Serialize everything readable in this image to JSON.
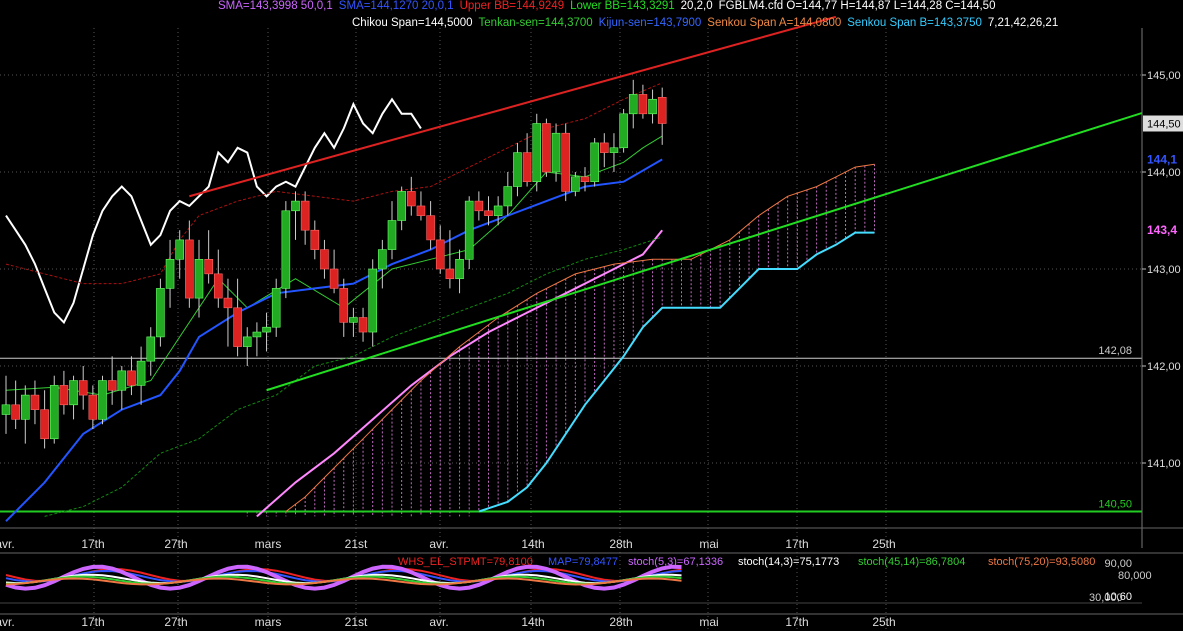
{
  "header": {
    "line1": [
      {
        "text": "SMA=143,3998  50,0,1",
        "color": "#cc66ff"
      },
      {
        "text": "SMA=144,1270  20,0,1",
        "color": "#3355ff"
      },
      {
        "text": "Upper BB=144,9249",
        "color": "#ee2222"
      },
      {
        "text": "Lower BB=143,3291",
        "color": "#22dd22"
      },
      {
        "text": "20,2,0",
        "color": "#ffffff"
      },
      {
        "text": "FGBLM4.cfd O=144,77 H=144,87 L=144,28 C=144,50",
        "color": "#ffffff"
      }
    ],
    "line2": [
      {
        "text": "Chikou Span=144,5000",
        "color": "#ffffff"
      },
      {
        "text": "Tenkan-sen=144,3700",
        "color": "#33cc33"
      },
      {
        "text": "Kijun-sen=143,7900",
        "color": "#3366ff"
      },
      {
        "text": "Senkou Span A=144,0800",
        "color": "#ee8844"
      },
      {
        "text": "Senkou Span B=143,3750",
        "color": "#33ccff"
      },
      {
        "text": "7,21,42,26,21",
        "color": "#ffffff"
      }
    ]
  },
  "chart_data": {
    "type": "candlestick",
    "symbol": "FGBLM4.cfd",
    "ylim": [
      140.4,
      145.4
    ],
    "y_ticks": [
      "145,00",
      "144,00",
      "143,00",
      "142,00",
      "141,00"
    ],
    "x_labels": [
      "avr.",
      "17th",
      "27th",
      "mars",
      "21st",
      "avr.",
      "14th",
      "28th",
      "mai",
      "17th",
      "25th"
    ],
    "price_tag": {
      "value": 144.5,
      "label": "144,50",
      "color": "#cccccc"
    },
    "indicator_tags": [
      {
        "value": 144.13,
        "label": "144,1",
        "color": "#3355ff"
      },
      {
        "value": 143.4,
        "label": "143,4",
        "color": "#ff66ff"
      }
    ],
    "hlines": [
      {
        "value": 142.08,
        "label": "142,08",
        "color": "#cccccc"
      },
      {
        "value": 140.5,
        "label": "140,50",
        "color": "#22cc22"
      }
    ],
    "trendlines": [
      {
        "name": "upper-trendline",
        "color": "#dd2222",
        "x1": 19,
        "y1": 143.75,
        "x2": 86,
        "y2": 145.6
      },
      {
        "name": "lower-trendline",
        "color": "#22dd22",
        "x1": 27,
        "y1": 141.75,
        "x2": 120,
        "y2": 144.68
      }
    ],
    "candles": [
      [
        141.5,
        141.9,
        141.3,
        141.6
      ],
      [
        141.6,
        141.85,
        141.35,
        141.45
      ],
      [
        141.45,
        141.8,
        141.2,
        141.7
      ],
      [
        141.7,
        141.85,
        141.4,
        141.55
      ],
      [
        141.55,
        141.75,
        141.15,
        141.25
      ],
      [
        141.25,
        141.9,
        141.2,
        141.8
      ],
      [
        141.8,
        141.95,
        141.5,
        141.6
      ],
      [
        141.6,
        141.9,
        141.45,
        141.85
      ],
      [
        141.85,
        142.0,
        141.55,
        141.7
      ],
      [
        141.7,
        141.8,
        141.35,
        141.45
      ],
      [
        141.45,
        141.9,
        141.4,
        141.85
      ],
      [
        141.85,
        142.1,
        141.6,
        141.75
      ],
      [
        141.75,
        142.0,
        141.55,
        141.95
      ],
      [
        141.95,
        142.1,
        141.7,
        141.8
      ],
      [
        141.8,
        142.2,
        141.6,
        142.05
      ],
      [
        142.05,
        142.4,
        141.9,
        142.3
      ],
      [
        142.3,
        142.9,
        142.2,
        142.8
      ],
      [
        142.8,
        143.3,
        142.6,
        143.1
      ],
      [
        143.1,
        143.4,
        142.9,
        143.3
      ],
      [
        143.3,
        143.5,
        142.6,
        142.7
      ],
      [
        142.7,
        143.3,
        142.5,
        143.1
      ],
      [
        143.1,
        143.4,
        142.85,
        142.95
      ],
      [
        142.95,
        143.2,
        142.6,
        142.7
      ],
      [
        142.7,
        142.9,
        142.2,
        142.6
      ],
      [
        142.6,
        142.9,
        142.1,
        142.2
      ],
      [
        142.2,
        142.4,
        142.0,
        142.3
      ],
      [
        142.3,
        142.45,
        142.1,
        142.35
      ],
      [
        142.35,
        142.55,
        142.15,
        142.4
      ],
      [
        142.4,
        142.9,
        142.3,
        142.8
      ],
      [
        142.8,
        143.7,
        142.7,
        143.6
      ],
      [
        143.6,
        143.8,
        143.3,
        143.7
      ],
      [
        143.7,
        143.8,
        143.25,
        143.4
      ],
      [
        143.4,
        143.5,
        143.1,
        143.2
      ],
      [
        143.2,
        143.3,
        142.9,
        143.0
      ],
      [
        143.0,
        143.2,
        142.75,
        142.8
      ],
      [
        142.8,
        142.9,
        142.3,
        142.45
      ],
      [
        142.45,
        142.6,
        142.3,
        142.5
      ],
      [
        142.5,
        142.6,
        142.25,
        142.35
      ],
      [
        142.35,
        143.1,
        142.2,
        143.0
      ],
      [
        143.0,
        143.3,
        142.8,
        143.2
      ],
      [
        143.2,
        143.7,
        143.1,
        143.5
      ],
      [
        143.5,
        143.85,
        143.4,
        143.8
      ],
      [
        143.8,
        143.95,
        143.55,
        143.65
      ],
      [
        143.65,
        143.8,
        143.5,
        143.55
      ],
      [
        143.55,
        143.7,
        143.2,
        143.3
      ],
      [
        143.3,
        143.45,
        142.95,
        143.0
      ],
      [
        143.0,
        143.4,
        142.8,
        142.9
      ],
      [
        142.9,
        143.2,
        142.75,
        143.1
      ],
      [
        143.1,
        143.75,
        143.0,
        143.7
      ],
      [
        143.7,
        143.8,
        143.5,
        143.6
      ],
      [
        143.6,
        143.75,
        143.45,
        143.55
      ],
      [
        143.55,
        143.75,
        143.45,
        143.65
      ],
      [
        143.65,
        144.0,
        143.55,
        143.85
      ],
      [
        143.85,
        144.3,
        143.75,
        144.2
      ],
      [
        144.2,
        144.4,
        143.85,
        143.9
      ],
      [
        143.9,
        144.6,
        143.8,
        144.5
      ],
      [
        144.5,
        144.55,
        143.95,
        144.0
      ],
      [
        144.0,
        144.5,
        143.9,
        144.4
      ],
      [
        144.4,
        144.5,
        143.7,
        143.8
      ],
      [
        143.8,
        144.0,
        143.75,
        143.95
      ],
      [
        143.95,
        144.05,
        143.8,
        143.9
      ],
      [
        143.9,
        144.35,
        143.85,
        144.3
      ],
      [
        144.3,
        144.4,
        144.05,
        144.2
      ],
      [
        144.2,
        144.4,
        144.0,
        144.25
      ],
      [
        144.25,
        144.65,
        144.2,
        144.6
      ],
      [
        144.6,
        144.95,
        144.45,
        144.8
      ],
      [
        144.8,
        144.9,
        144.55,
        144.6
      ],
      [
        144.6,
        144.85,
        144.5,
        144.75
      ],
      [
        144.77,
        144.87,
        144.28,
        144.5
      ]
    ],
    "series": [
      {
        "key": "chikou",
        "color": "#ffffff",
        "width": 2,
        "points": [
          [
            0,
            143.55
          ],
          [
            1,
            143.4
          ],
          [
            2,
            143.25
          ],
          [
            3,
            143.05
          ],
          [
            4,
            142.8
          ],
          [
            5,
            142.55
          ],
          [
            6,
            142.45
          ],
          [
            7,
            142.65
          ],
          [
            8,
            143.0
          ],
          [
            9,
            143.35
          ],
          [
            10,
            143.6
          ],
          [
            11,
            143.75
          ],
          [
            12,
            143.85
          ],
          [
            13,
            143.75
          ],
          [
            14,
            143.5
          ],
          [
            15,
            143.25
          ],
          [
            16,
            143.35
          ],
          [
            17,
            143.6
          ],
          [
            18,
            143.7
          ],
          [
            19,
            143.65
          ],
          [
            20,
            143.75
          ],
          [
            21,
            143.85
          ],
          [
            22,
            144.2
          ],
          [
            23,
            144.1
          ],
          [
            24,
            144.25
          ],
          [
            25,
            144.2
          ],
          [
            26,
            143.85
          ],
          [
            27,
            143.75
          ],
          [
            28,
            143.85
          ],
          [
            29,
            143.9
          ],
          [
            30,
            143.85
          ],
          [
            31,
            144.05
          ],
          [
            32,
            144.25
          ],
          [
            33,
            144.4
          ],
          [
            34,
            144.25
          ],
          [
            35,
            144.45
          ],
          [
            36,
            144.7
          ],
          [
            37,
            144.5
          ],
          [
            38,
            144.4
          ],
          [
            39,
            144.6
          ],
          [
            40,
            144.75
          ],
          [
            41,
            144.6
          ],
          [
            42,
            144.6
          ],
          [
            43,
            144.45
          ]
        ]
      },
      {
        "key": "tenkan",
        "color": "#33cc33",
        "width": 1,
        "points": [
          [
            0,
            141.75
          ],
          [
            5,
            141.78
          ],
          [
            10,
            141.7
          ],
          [
            15,
            141.85
          ],
          [
            18,
            142.3
          ],
          [
            22,
            142.9
          ],
          [
            25,
            142.6
          ],
          [
            30,
            142.9
          ],
          [
            35,
            142.6
          ],
          [
            40,
            143.0
          ],
          [
            44,
            143.1
          ],
          [
            48,
            143.2
          ],
          [
            52,
            143.55
          ],
          [
            56,
            144.0
          ],
          [
            60,
            143.95
          ],
          [
            64,
            144.1
          ],
          [
            66,
            144.25
          ],
          [
            68,
            144.37
          ]
        ]
      },
      {
        "key": "kijun",
        "color": "#2255ff",
        "width": 2,
        "points": [
          [
            0,
            140.4
          ],
          [
            4,
            140.8
          ],
          [
            8,
            141.3
          ],
          [
            12,
            141.55
          ],
          [
            16,
            141.7
          ],
          [
            18,
            141.95
          ],
          [
            20,
            142.3
          ],
          [
            24,
            142.55
          ],
          [
            28,
            142.75
          ],
          [
            32,
            142.8
          ],
          [
            36,
            142.85
          ],
          [
            40,
            143.05
          ],
          [
            44,
            143.2
          ],
          [
            48,
            143.4
          ],
          [
            52,
            143.55
          ],
          [
            56,
            143.7
          ],
          [
            60,
            143.85
          ],
          [
            64,
            143.9
          ],
          [
            68,
            144.13
          ]
        ]
      },
      {
        "key": "sma50",
        "color": "#ff88ff",
        "width": 2,
        "points": [
          [
            26,
            140.45
          ],
          [
            30,
            140.8
          ],
          [
            34,
            141.1
          ],
          [
            38,
            141.45
          ],
          [
            42,
            141.8
          ],
          [
            46,
            142.1
          ],
          [
            50,
            142.35
          ],
          [
            54,
            142.55
          ],
          [
            58,
            142.75
          ],
          [
            62,
            142.95
          ],
          [
            66,
            143.15
          ],
          [
            68,
            143.4
          ]
        ]
      },
      {
        "key": "bb_upper",
        "color": "#aa1111",
        "width": 1,
        "dash": "3,2",
        "points": [
          [
            0,
            143.05
          ],
          [
            4,
            142.95
          ],
          [
            8,
            142.85
          ],
          [
            12,
            142.85
          ],
          [
            16,
            142.95
          ],
          [
            18,
            143.3
          ],
          [
            20,
            143.55
          ],
          [
            24,
            143.7
          ],
          [
            28,
            143.8
          ],
          [
            32,
            143.75
          ],
          [
            36,
            143.7
          ],
          [
            40,
            143.8
          ],
          [
            44,
            143.85
          ],
          [
            48,
            144.05
          ],
          [
            52,
            144.25
          ],
          [
            56,
            144.45
          ],
          [
            60,
            144.55
          ],
          [
            64,
            144.75
          ],
          [
            68,
            144.92
          ]
        ]
      },
      {
        "key": "bb_lower",
        "color": "#118811",
        "width": 1,
        "dash": "3,2",
        "points": [
          [
            4,
            140.45
          ],
          [
            8,
            140.55
          ],
          [
            12,
            140.75
          ],
          [
            16,
            141.1
          ],
          [
            20,
            141.25
          ],
          [
            24,
            141.55
          ],
          [
            28,
            141.7
          ],
          [
            32,
            142.0
          ],
          [
            36,
            142.1
          ],
          [
            40,
            142.3
          ],
          [
            44,
            142.45
          ],
          [
            48,
            142.6
          ],
          [
            52,
            142.75
          ],
          [
            56,
            142.95
          ],
          [
            60,
            143.1
          ],
          [
            64,
            143.2
          ],
          [
            68,
            143.33
          ]
        ]
      },
      {
        "key": "senkou_a",
        "color": "#ee7744",
        "width": 1,
        "points": [
          [
            29,
            140.5
          ],
          [
            31,
            140.65
          ],
          [
            33,
            140.85
          ],
          [
            35,
            141.05
          ],
          [
            37,
            141.25
          ],
          [
            40,
            141.55
          ],
          [
            43,
            141.85
          ],
          [
            47,
            142.2
          ],
          [
            51,
            142.5
          ],
          [
            55,
            142.75
          ],
          [
            59,
            142.95
          ],
          [
            63,
            143.05
          ],
          [
            67,
            143.1
          ],
          [
            71,
            143.1
          ],
          [
            75,
            143.3
          ],
          [
            78,
            143.55
          ],
          [
            81,
            143.75
          ],
          [
            84,
            143.85
          ],
          [
            86,
            143.95
          ],
          [
            88,
            144.05
          ],
          [
            90,
            144.08
          ]
        ]
      },
      {
        "key": "senkou_b",
        "color": "#44ddff",
        "width": 2,
        "points": [
          [
            49,
            140.5
          ],
          [
            52,
            140.6
          ],
          [
            54,
            140.75
          ],
          [
            56,
            141.0
          ],
          [
            58,
            141.3
          ],
          [
            60,
            141.6
          ],
          [
            62,
            141.85
          ],
          [
            64,
            142.1
          ],
          [
            66,
            142.4
          ],
          [
            68,
            142.6
          ],
          [
            70,
            142.6
          ],
          [
            72,
            142.6
          ],
          [
            74,
            142.6
          ],
          [
            76,
            142.8
          ],
          [
            78,
            143.0
          ],
          [
            80,
            143.0
          ],
          [
            82,
            143.0
          ],
          [
            84,
            143.15
          ],
          [
            86,
            143.25
          ],
          [
            88,
            143.375
          ],
          [
            90,
            143.375
          ]
        ]
      }
    ],
    "oscillator": {
      "tags": [
        {
          "label": "90,00",
          "color": "#cccccc"
        },
        {
          "label": "80,000",
          "color": "#cccccc"
        },
        {
          "label": "10,60",
          "color": "#ffffff"
        },
        {
          "label": "30,000",
          "color": "#cccccc"
        }
      ],
      "legend": [
        {
          "text": "WHS_EL_STPMT=79,8100",
          "color": "#ee2222"
        },
        {
          "text": "MAP=79,8477",
          "color": "#3355ff"
        },
        {
          "text": "stoch(5,3)=67,1336",
          "color": "#cc66ff"
        },
        {
          "text": "stoch(14,3)=75,1773",
          "color": "#ffffff"
        },
        {
          "text": "stoch(45,14)=86,7804",
          "color": "#33cc33"
        },
        {
          "text": "stoch(75,20)=93,5080",
          "color": "#ee7744"
        }
      ]
    }
  }
}
